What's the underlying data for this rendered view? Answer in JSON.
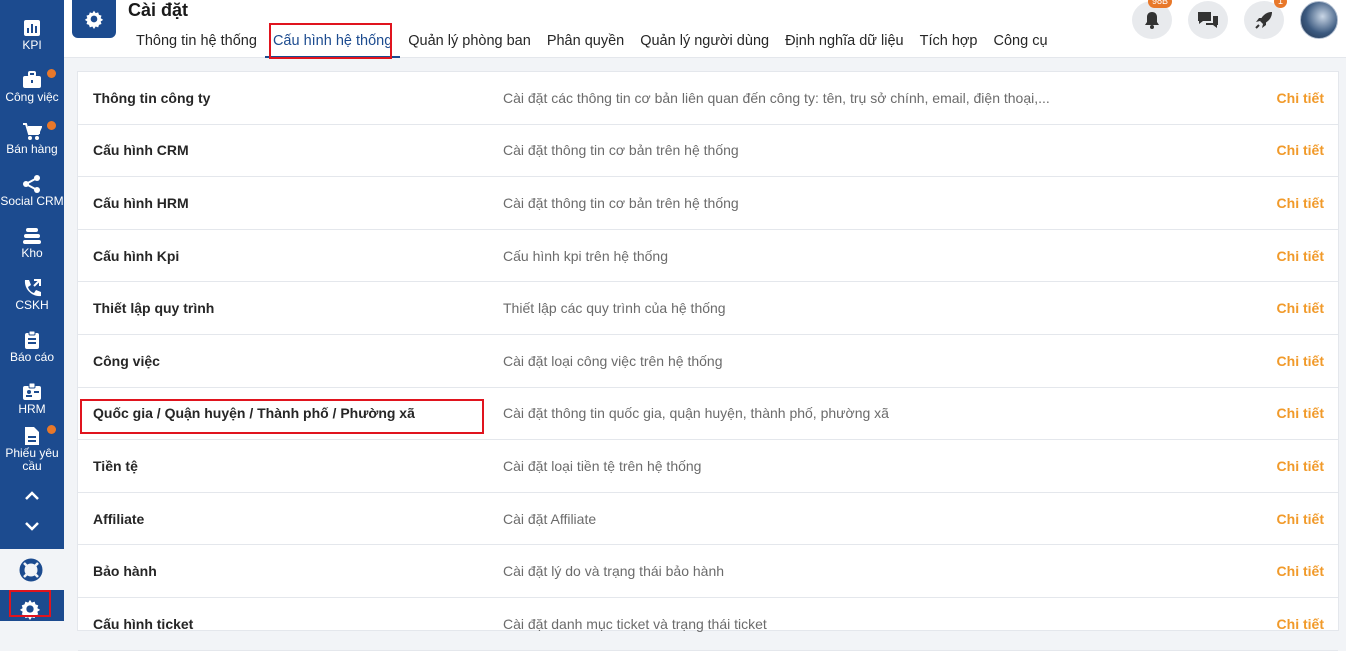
{
  "sidebar": {
    "items": [
      {
        "label": "KPI",
        "icon": "kpi-chart-icon",
        "dot": false
      },
      {
        "label": "Công việc",
        "icon": "briefcase-icon",
        "dot": true
      },
      {
        "label": "Bán hàng",
        "icon": "cart-icon",
        "dot": true
      },
      {
        "label": "Social CRM",
        "icon": "share-icon",
        "dot": false
      },
      {
        "label": "Kho",
        "icon": "warehouse-icon",
        "dot": false
      },
      {
        "label": "CSKH",
        "icon": "phone-icon",
        "dot": false
      },
      {
        "label": "Báo cáo",
        "icon": "clipboard-icon",
        "dot": false
      },
      {
        "label": "HRM",
        "icon": "id-badge-icon",
        "dot": false
      },
      {
        "label": "Phiếu yêu cầu",
        "icon": "document-icon",
        "dot": true
      }
    ],
    "scroll_up_icon": "chevron-up-icon",
    "scroll_down_icon": "chevron-down-icon",
    "help_icon": "lifebuoy-icon",
    "settings_icon": "gear-icon",
    "accent_color": "#1c4b8f"
  },
  "header": {
    "title": "Cài đặt",
    "tabs": [
      {
        "label": "Thông tin hệ thống",
        "active": false
      },
      {
        "label": "Cấu hình hệ thống",
        "active": true
      },
      {
        "label": "Quản lý phòng ban",
        "active": false
      },
      {
        "label": "Phân quyền",
        "active": false
      },
      {
        "label": "Quản lý người dùng",
        "active": false
      },
      {
        "label": "Định nghĩa dữ liệu",
        "active": false
      },
      {
        "label": "Tích hợp",
        "active": false
      },
      {
        "label": "Công cụ",
        "active": false
      }
    ],
    "notifications_badge": "98B",
    "rocket_badge": "1"
  },
  "settings_rows": [
    {
      "name": "Thông tin công ty",
      "desc": "Cài đặt các thông tin cơ bản liên quan đến công ty: tên, trụ sở chính, email, điện thoại,...",
      "link": "Chi tiết"
    },
    {
      "name": "Cấu hình CRM",
      "desc": "Cài đặt thông tin cơ bản trên hệ thống",
      "link": "Chi tiết"
    },
    {
      "name": "Cấu hình HRM",
      "desc": "Cài đặt thông tin cơ bản trên hệ thống",
      "link": "Chi tiết"
    },
    {
      "name": "Cấu hình Kpi",
      "desc": "Cấu hình kpi trên hệ thống",
      "link": "Chi tiết"
    },
    {
      "name": "Thiết lập quy trình",
      "desc": "Thiết lập các quy trình của hệ thống",
      "link": "Chi tiết"
    },
    {
      "name": "Công việc",
      "desc": "Cài đặt loại công việc trên hệ thống",
      "link": "Chi tiết"
    },
    {
      "name": "Quốc gia / Quận huyện / Thành phố / Phường xã",
      "desc": "Cài đặt thông tin quốc gia, quận huyện, thành phố, phường xã",
      "link": "Chi tiết"
    },
    {
      "name": "Tiền tệ",
      "desc": "Cài đặt loại tiền tệ trên hệ thống",
      "link": "Chi tiết"
    },
    {
      "name": "Affiliate",
      "desc": "Cài đặt Affiliate",
      "link": "Chi tiết"
    },
    {
      "name": "Bảo hành",
      "desc": "Cài đặt lý do và trạng thái bảo hành",
      "link": "Chi tiết"
    },
    {
      "name": "Cấu hình ticket",
      "desc": "Cài đặt danh mục ticket và trạng thái ticket",
      "link": "Chi tiết"
    }
  ],
  "colors": {
    "link": "#f19a2a",
    "highlight": "#e0141e",
    "dot": "#e8782a"
  }
}
